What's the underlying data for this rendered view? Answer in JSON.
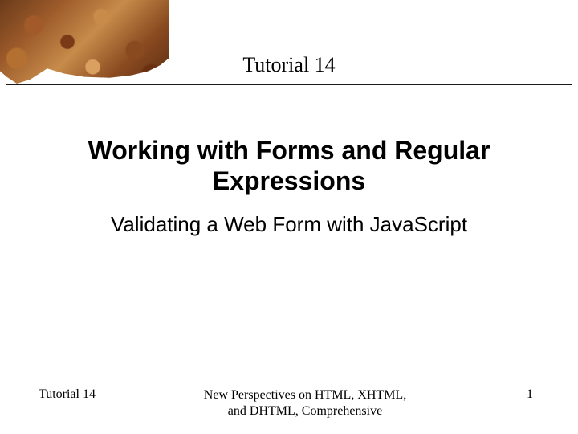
{
  "header": {
    "chapter_label": "Tutorial 14"
  },
  "main": {
    "title": "Working with Forms and Regular Expressions",
    "subtitle": "Validating a Web Form with JavaScript"
  },
  "footer": {
    "left": "Tutorial 14",
    "center_line1": "New Perspectives on HTML, XHTML,",
    "center_line2": "and DHTML, Comprehensive",
    "page_number": "1"
  }
}
